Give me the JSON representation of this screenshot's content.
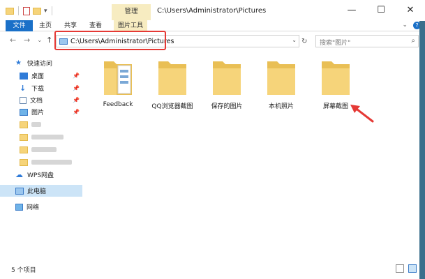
{
  "window": {
    "title": "C:\\Users\\Administrator\\Pictures",
    "context_tab": "管理",
    "controls": {
      "minimize": "—",
      "maximize": "☐",
      "close": "✕"
    }
  },
  "ribbon": {
    "tabs": [
      "文件",
      "主页",
      "共享",
      "查看"
    ],
    "context_subtab": "图片工具",
    "collapse": "⌄",
    "help": "?"
  },
  "nav": {
    "back": "←",
    "forward": "→",
    "recent": "⌄",
    "up": "↑"
  },
  "address": {
    "path": "C:\\Users\\Administrator\\Pictures",
    "dropdown": "⌄",
    "refresh": "↻"
  },
  "search": {
    "placeholder": "搜索\"图片\"",
    "icon": "⌕"
  },
  "sidebar": {
    "quick_access": "快速访问",
    "quick_items": [
      "桌面",
      "下载",
      "文档",
      "图片"
    ],
    "wps": "WPS网盘",
    "this_pc": "此电脑",
    "network": "网络",
    "pin": "📌"
  },
  "files": [
    "Feedback",
    "QQ浏览器截图",
    "保存的图片",
    "本机照片",
    "屏幕截图"
  ],
  "status": {
    "count": "5 个项目"
  },
  "colors": {
    "accent": "#1a70c8",
    "folder": "#f6d47a",
    "annotation": "#e53935",
    "selected": "#cce4f7"
  }
}
